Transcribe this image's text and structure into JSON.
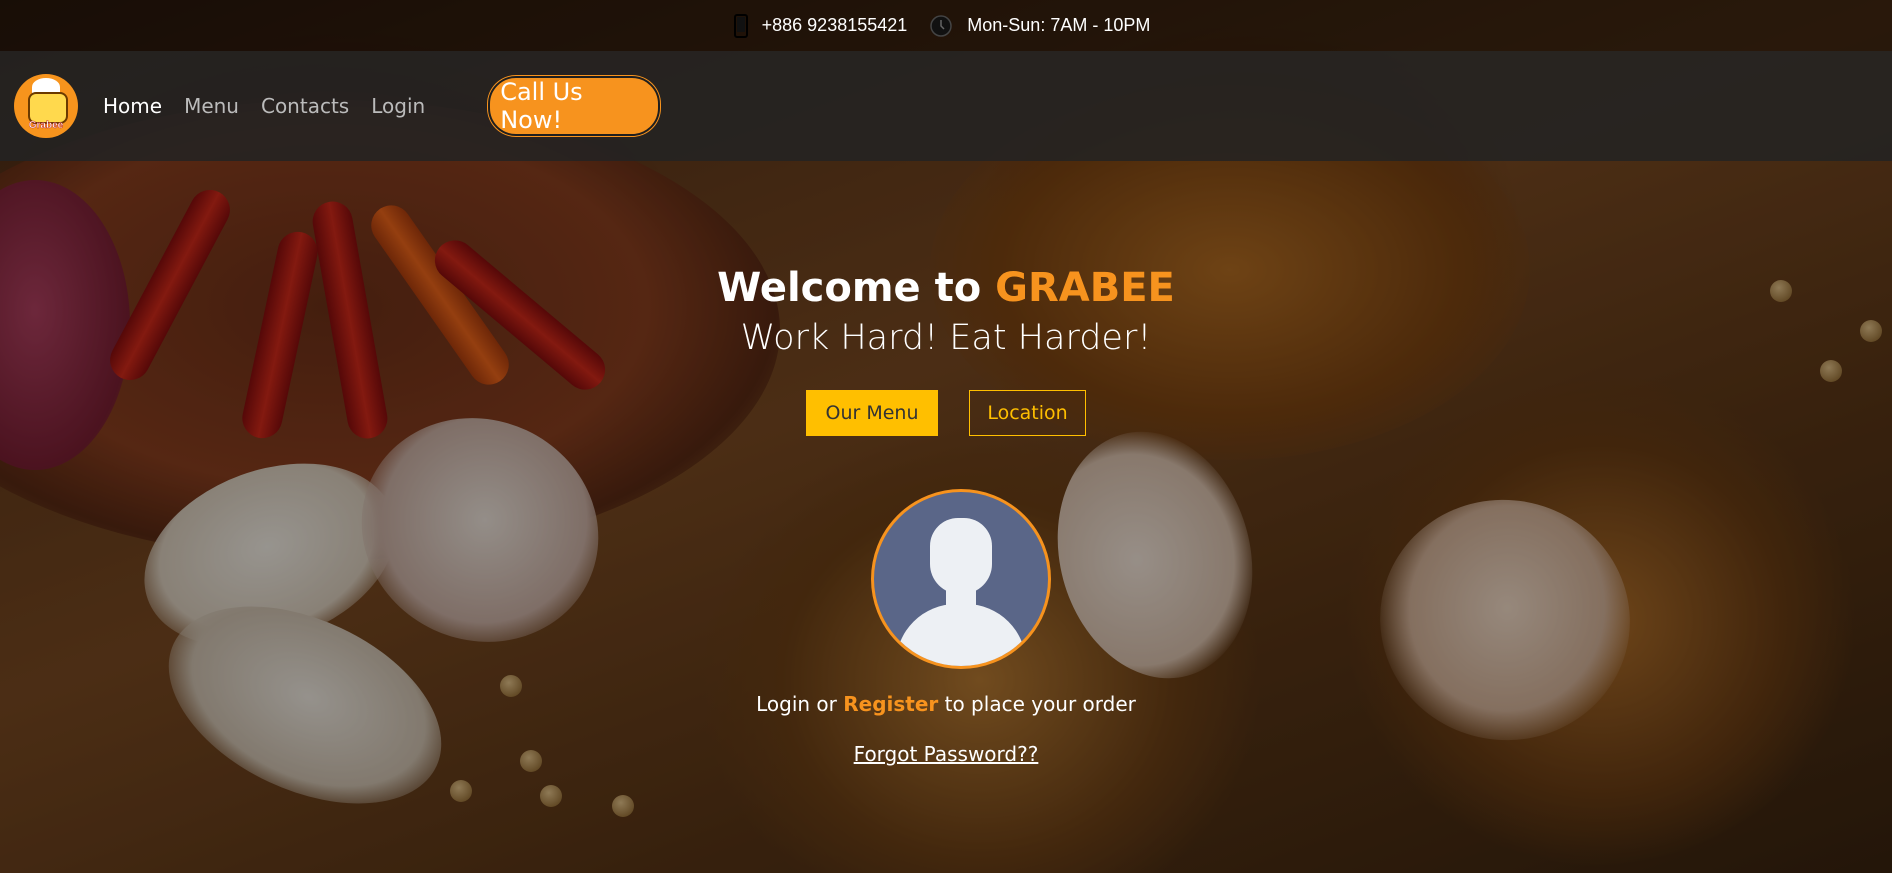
{
  "topbar": {
    "phone_icon": "phone-icon",
    "phone": "+886 9238155421",
    "clock_icon": "clock-icon",
    "hours": "Mon-Sun: 7AM - 10PM"
  },
  "nav": {
    "logo_text": "Grabee",
    "items": [
      {
        "label": "Home",
        "active": true
      },
      {
        "label": "Menu",
        "active": false
      },
      {
        "label": "Contacts",
        "active": false
      },
      {
        "label": "Login",
        "active": false
      }
    ],
    "call_button": "Call Us Now!"
  },
  "hero": {
    "welcome_prefix": "Welcome to",
    "brand": "GRABEE",
    "tagline": "Work Hard! Eat Harder!",
    "menu_button": "Our Menu",
    "location_button": "Location"
  },
  "auth": {
    "avatar_icon": "user-avatar-icon",
    "prefix": "Login or",
    "register": "Register",
    "suffix": "to place your order",
    "forgot": "Forgot Password??"
  },
  "colors": {
    "accent": "#f7931e",
    "button_yellow": "#ffbf00",
    "nav_bg": "#232323"
  }
}
